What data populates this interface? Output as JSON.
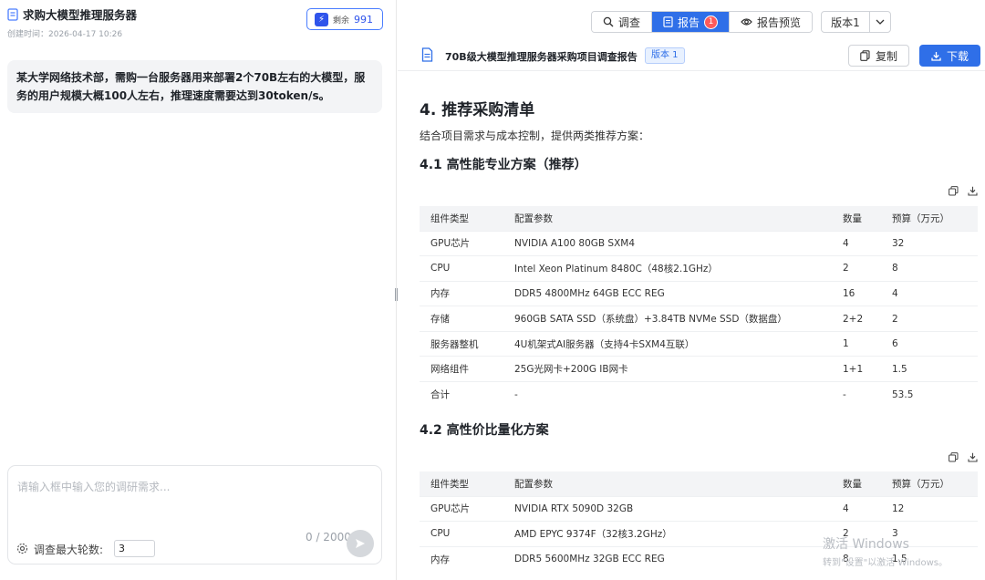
{
  "left": {
    "title": "求购大模型推理服务器",
    "created": "创建时间：2026-04-17 10:26",
    "credits_label": "剩余",
    "credits_value": "991",
    "message": "某大学网络技术部，需购一台服务器用来部署2个70B左右的大模型，服务的用户规模大概100人左右，推理速度需要达到30token/s。",
    "composer": {
      "placeholder": "请输入框中输入您的调研需求...",
      "rounds_label": "调查最大轮数:",
      "rounds_value": "3",
      "counter": "0 / 2000"
    }
  },
  "right": {
    "tabs": [
      {
        "label": "调查",
        "icon": "search-icon"
      },
      {
        "label": "报告",
        "icon": "doc-icon",
        "badge": "1"
      },
      {
        "label": "报告预览",
        "icon": "eye-icon"
      }
    ],
    "version_select": "版本1",
    "report_title": "70B级大模型推理服务器采购项目调查报告",
    "version_tag": "版本 1",
    "copy_label": "复制",
    "download_label": "下载",
    "section_title": "4. 推荐采购清单",
    "intro": "结合项目需求与成本控制，提供两类推荐方案：",
    "plan1_title": "4.1 高性能专业方案（推荐）",
    "plan2_title": "4.2 高性价比量化方案",
    "columns": [
      "组件类型",
      "配置参数",
      "数量",
      "预算（万元）"
    ],
    "plan1_rows": [
      [
        "GPU芯片",
        "NVIDIA A100 80GB SXM4",
        "4",
        "32"
      ],
      [
        "CPU",
        "Intel Xeon Platinum 8480C（48核2.1GHz）",
        "2",
        "8"
      ],
      [
        "内存",
        "DDR5 4800MHz 64GB ECC REG",
        "16",
        "4"
      ],
      [
        "存储",
        "960GB SATA SSD（系统盘）+3.84TB NVMe SSD（数据盘）",
        "2+2",
        "2"
      ],
      [
        "服务器整机",
        "4U机架式AI服务器（支持4卡SXM4互联）",
        "1",
        "6"
      ],
      [
        "网络组件",
        "25G光网卡+200G IB网卡",
        "1+1",
        "1.5"
      ],
      [
        "合计",
        "-",
        "-",
        "53.5"
      ]
    ],
    "plan2_rows": [
      [
        "GPU芯片",
        "NVIDIA RTX 5090D 32GB",
        "4",
        "12"
      ],
      [
        "CPU",
        "AMD EPYC 9374F（32核3.2GHz）",
        "2",
        "3"
      ],
      [
        "内存",
        "DDR5 5600MHz 32GB ECC REG",
        "8",
        "1.5"
      ]
    ]
  },
  "watermark": {
    "line1": "激活 Windows",
    "line2": "转到\"设置\"以激活 Windows。"
  }
}
